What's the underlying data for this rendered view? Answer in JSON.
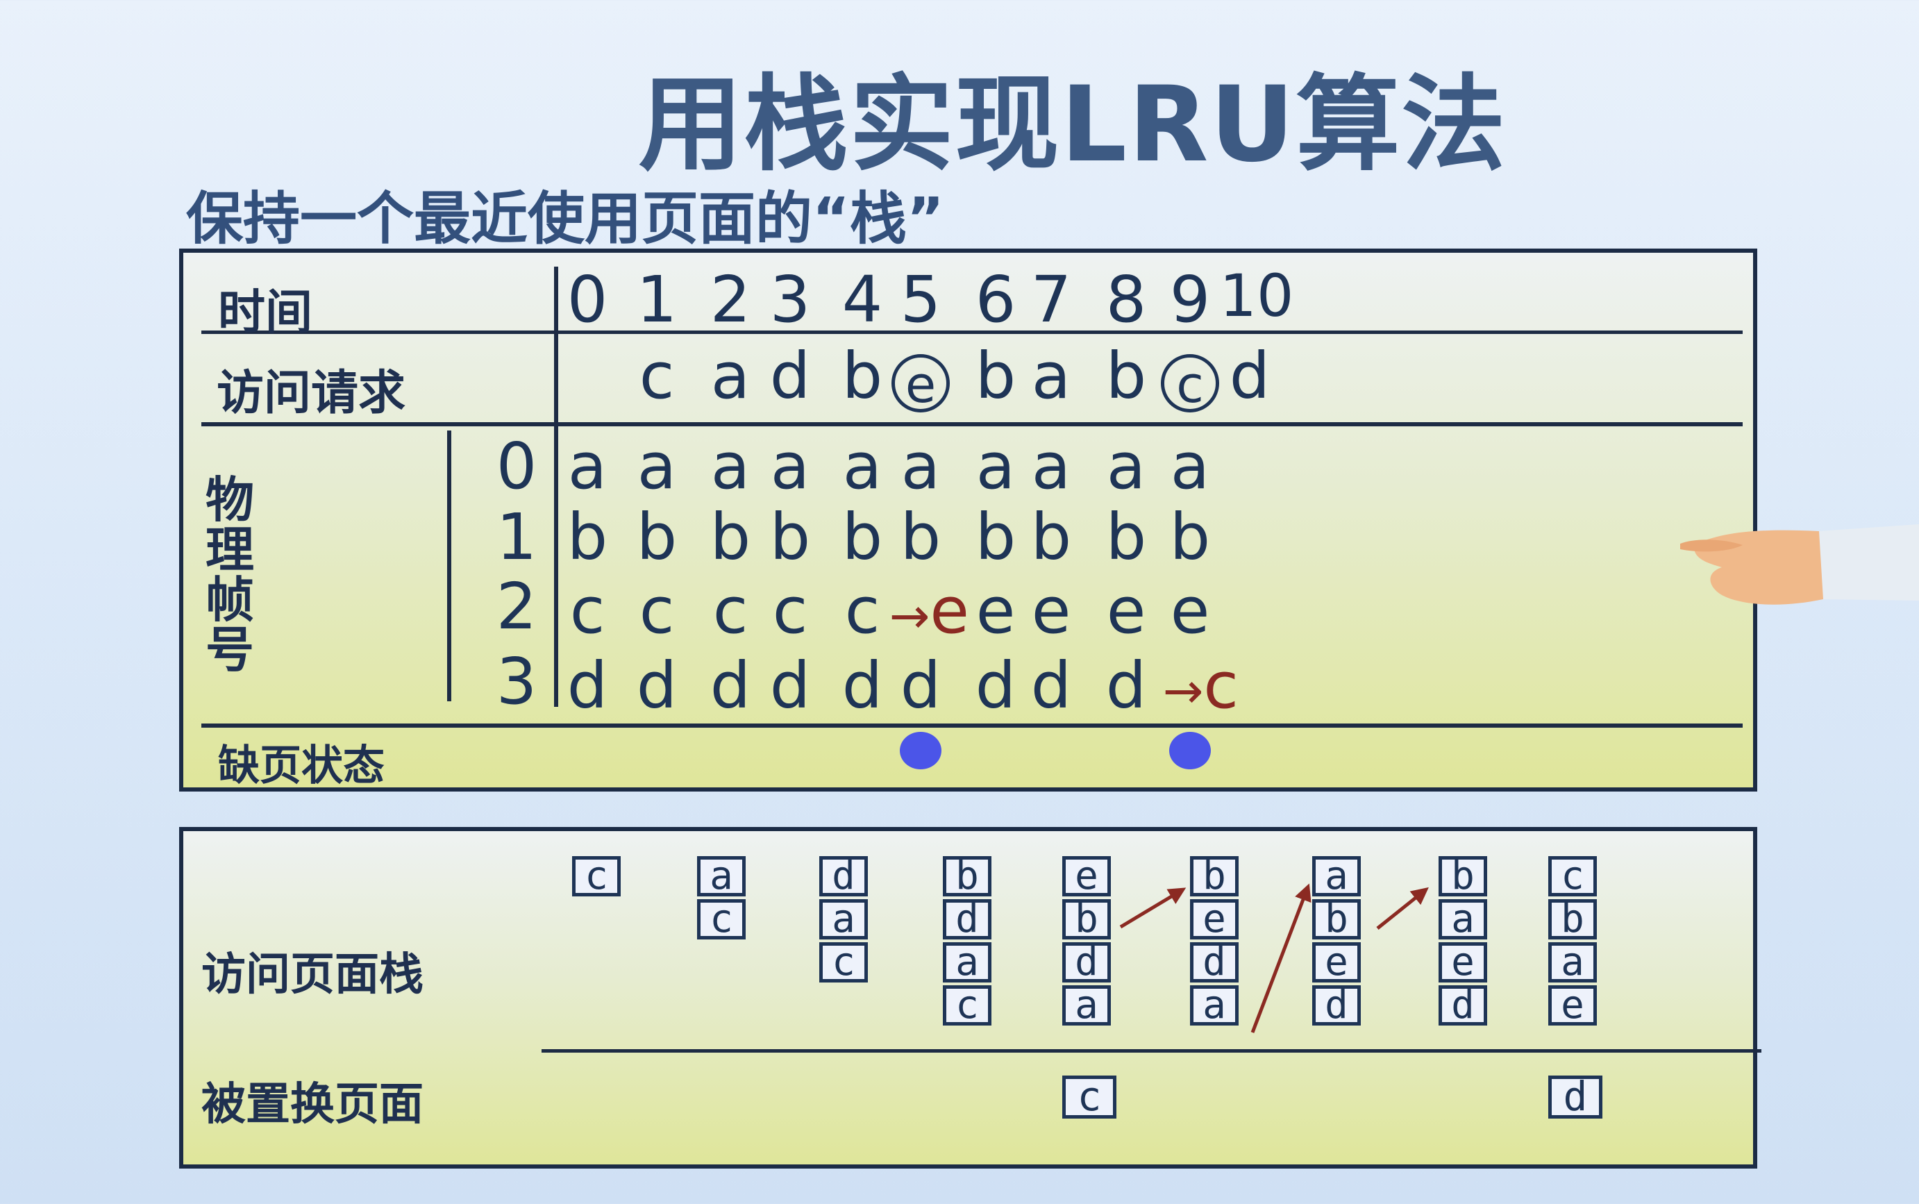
{
  "title": "用栈实现LRU算法",
  "subtitle": "保持一个最近使用页面的“栈”",
  "table": {
    "time_label": "时间",
    "request_label": "访问请求",
    "frame_label": "物理帧号",
    "fault_label": "缺页状态",
    "times": [
      "0",
      "1",
      "2",
      "3",
      "4",
      "5",
      "6",
      "7",
      "8",
      "9",
      "10"
    ],
    "requests": [
      "c",
      "a",
      "d",
      "b",
      "e",
      "b",
      "a",
      "b",
      "c",
      "d"
    ],
    "faulted_times": [
      "5",
      "9"
    ],
    "frame_numbers": [
      "0",
      "1",
      "2",
      "3"
    ],
    "columns": [
      {
        "f0": "a",
        "f1": "b",
        "f2": "c",
        "f3": "d"
      },
      {
        "f0": "a",
        "f1": "b",
        "f2": "c",
        "f3": "d"
      },
      {
        "f0": "a",
        "f1": "b",
        "f2": "c",
        "f3": "d"
      },
      {
        "f0": "a",
        "f1": "b",
        "f2": "c",
        "f3": "d"
      },
      {
        "f0": "a",
        "f1": "b",
        "f2": "c",
        "f3": "d"
      },
      {
        "f0": "a",
        "f1": "b",
        "f2": "e",
        "f3": "d"
      },
      {
        "f0": "a",
        "f1": "b",
        "f2": "e",
        "f3": "d"
      },
      {
        "f0": "a",
        "f1": "b",
        "f2": "e",
        "f3": "d"
      },
      {
        "f0": "a",
        "f1": "b",
        "f2": "e",
        "f3": "d"
      },
      {
        "f0": "a",
        "f1": "b",
        "f2": "e",
        "f3": "c"
      },
      {
        "f0": "",
        "f1": "",
        "f2": "",
        "f3": ""
      }
    ],
    "replace_arrow": "→"
  },
  "stack_section": {
    "stack_label": "访问页面栈",
    "replaced_label": "被置换页面",
    "stacks": [
      [
        "c"
      ],
      [
        "a",
        "c"
      ],
      [
        "d",
        "a",
        "c"
      ],
      [
        "b",
        "d",
        "a",
        "c"
      ],
      [
        "e",
        "b",
        "d",
        "a"
      ],
      [
        "b",
        "e",
        "d",
        "a"
      ],
      [
        "a",
        "b",
        "e",
        "d"
      ],
      [
        "b",
        "a",
        "e",
        "d"
      ],
      [
        "c",
        "b",
        "a",
        "e"
      ]
    ],
    "replaced_pages": [
      {
        "time": "5",
        "page": "c"
      },
      {
        "time": "9",
        "page": "d"
      }
    ]
  },
  "colors": {
    "title": "#3d5a83",
    "text": "#1e3456",
    "replacement": "#8b2a22",
    "fault_dot": "#4b55e8",
    "panel_yellow": "#dfe69a"
  }
}
